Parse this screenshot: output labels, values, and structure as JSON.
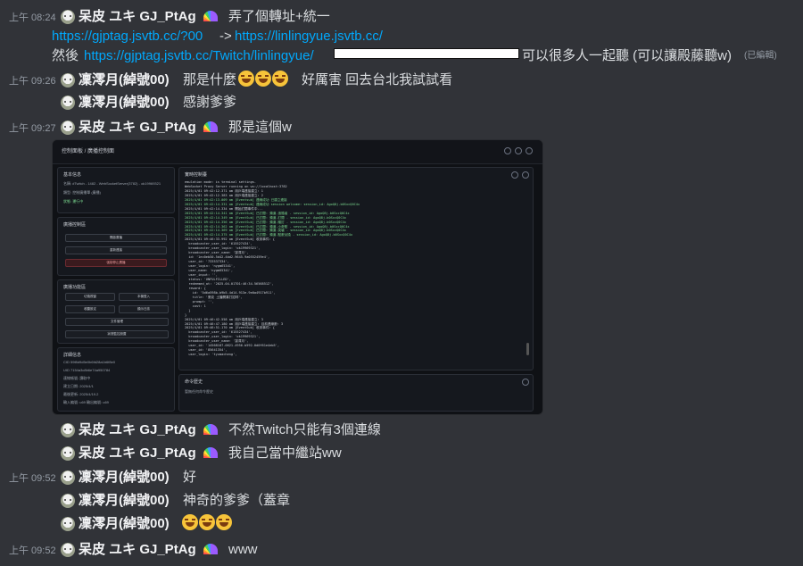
{
  "messages": [
    {
      "time": "上午 08:24",
      "name": "呆皮 ユキ GJ_PtAg",
      "text": "弄了個轉址+統一"
    },
    {
      "link_a": "https://gjptag.jsvtb.cc/?00",
      "arrow": "->",
      "link_b": "https://linlingyue.jsvtb.cc/"
    },
    {
      "prefix": "然後",
      "link": "https://gjptag.jsvtb.cc/Twitch/linlingyue/",
      "text": "可以很多人一起聽 (可以讓殿藤聽w)",
      "edited": "(已編輯)"
    },
    {
      "time": "上午 09:26",
      "name": "凜澪月(綽號00)",
      "text_a": "那是什麼",
      "text_b": "好厲害 回去台北我試試看"
    },
    {
      "name": "凜澪月(綽號00)",
      "text": "感謝爹爹"
    },
    {
      "time": "上午 09:27",
      "name": "呆皮 ユキ GJ_PtAg",
      "text": "那是這個w"
    },
    {
      "name": "呆皮 ユキ GJ_PtAg",
      "text": "不然Twitch只能有3個連線"
    },
    {
      "name": "呆皮 ユキ GJ_PtAg",
      "text": "我自己當中繼站ww"
    },
    {
      "time": "上午 09:52",
      "name": "凜澪月(綽號00)",
      "text": "好"
    },
    {
      "name": "凜澪月(綽號00)",
      "text": "神奇的爹爹（蓋章"
    },
    {
      "name": "凜澪月(綽號00)",
      "text": ""
    },
    {
      "time": "上午 09:52",
      "name": "呆皮 ユキ GJ_PtAg",
      "text": "www"
    }
  ],
  "embed": {
    "title": "控制面板 / 廣播控制面",
    "basic_title": "基本信息",
    "basic_lines": [
      "名稱: #Twitch - 1482 - WebSocketServer(3782) - ok19969321",
      "類型: 控制廣播單 (廣播)",
      "狀態: 運行中"
    ],
    "control_title": "廣播控制區",
    "control_buttons": [
      "開啟廣播",
      "重新連接",
      "強制停止廣播"
    ],
    "ops_title": "廣播功能區",
    "ops_buttons": [
      "切換視窗",
      "本機登入",
      "收聽設定",
      "顯示日誌",
      "文件管理",
      "狀態監控設置"
    ],
    "detail_title": "詳細信息",
    "detail_lines": [
      "CID 59f8d9d5e0b6fd28a1b6f8e0",
      "UID 7154a3c8b6e74a950784",
      "連線帳號: 讀取中",
      "建立日期: 2025/4/1",
      "最後更新: 2025/4/19.2",
      "輸入編號: u69 輸出編號: u69"
    ],
    "log_title": "實時控制臺",
    "log_lines": [
      {
        "t": "emulation mode: is terminal settings.",
        "g": false
      },
      {
        "t": "WebSocket Proxy Server running on ws://localhost:3782",
        "g": false
      },
      {
        "t": "2025/4/01 09:42:12.371 am 用戶端連接建立: 1",
        "g": false
      },
      {
        "t": "2025/4/01 09:42:12.383 am 用戶端連接建立: 2",
        "g": false
      },
      {
        "t": "2025/4/01 09:42:13.009 am [Eventsub] 連線成功 已建立連接",
        "g": true
      },
      {
        "t": "2025/4/01 09:42:14.331 am [Eventsub] 連線成功 session welcome: session_id: AgoQ8j-b0SxcQ0C4x",
        "g": true
      },
      {
        "t": "2025/4/01 09:42:14.334 am 開始訂閱事件中...",
        "g": false
      },
      {
        "t": "2025/4/01 09:42:14.341 am [EventSub] 已訂閱: 頻道.追隨者 - session_id: AgoQ8j-b0SxcQ0C4x",
        "g": true
      },
      {
        "t": "2025/4/01 09:42:14.349 am [EventSub] 已訂閱: 頻道.訂閱 - session_id: AgoQ8j-b0SxcQ0C4x",
        "g": true
      },
      {
        "t": "2025/4/01 09:42:14.356 am [EventSub] 已訂閱: 頻道.贈訂 - session_id: AgoQ8j-b0SxcQ0C4x",
        "g": true
      },
      {
        "t": "2025/4/01 09:42:14.362 am [EventSub] 已訂閱: 頻道.小奇點 - session_id: AgoQ8j-b0SxcQ0C4x",
        "g": true
      },
      {
        "t": "2025/4/01 09:42:14.369 am [EventSub] 已訂閱: 頻道.突襲 - session_id: AgoQ8j-b0SxcQ0C4x",
        "g": true
      },
      {
        "t": "2025/4/01 09:42:14.375 am [EventSub] 已訂閱: 頻道.點數兌換 - session_id: AgoQ8j-b0SxcQ0C4x",
        "g": true
      },
      {
        "t": "2025/4/01 09:46:33.992 am [EventSub] 收到事件: {",
        "g": false
      },
      {
        "t": "  broadcaster_user_id: '615527434',",
        "g": false
      },
      {
        "t": "  broadcaster_user_login: 'ok19969321',",
        "g": false
      },
      {
        "t": "  broadcaster_user_name: '凜澪月',",
        "g": false
      },
      {
        "t": "  id: '1ec0eb50-5d42-4bd2-9645-9a0552459e4',",
        "g": false
      },
      {
        "t": "  user_id: '733537334',",
        "g": false
      },
      {
        "t": "  user_login: 'nygm65341',",
        "g": false
      },
      {
        "t": "  user_name: 'nygm65341',",
        "g": false
      },
      {
        "t": "  user_input: '',",
        "g": false
      },
      {
        "t": "  status: 'UNFULFILLED',",
        "g": false
      },
      {
        "t": "  redeemed_at: '2025-04-01T01:46:34.5656851Z',",
        "g": false
      },
      {
        "t": "  reward: {",
        "g": false
      },
      {
        "t": "    id: '5d6a598b-b9b5-4d14-913e-9e0a4917b911',",
        "g": false
      },
      {
        "t": "    title: '麥克 土播開喜打招呼',",
        "g": false
      },
      {
        "t": "    prompt: '',",
        "g": false
      },
      {
        "t": "    cost: 1",
        "g": false
      },
      {
        "t": "  }",
        "g": false
      },
      {
        "t": "}",
        "g": false
      },
      {
        "t": "2025/4/01 09:46:42.558 am 用戶端連接建立: 3",
        "g": false
      },
      {
        "t": "2025/4/01 09:46:47.180 am 用戶端連接建立: 目前連線數: 3",
        "g": false
      },
      {
        "t": "2025/4/01 09:46:51.170 am [EventSub] 收到事件: {",
        "g": false
      },
      {
        "t": "  broadcaster_user_id: '615527434',",
        "g": false
      },
      {
        "t": "  broadcaster_user_login: 'ok19969321',",
        "g": false
      },
      {
        "t": "  broadcaster_user_name: '凜澪月',",
        "g": false
      },
      {
        "t": "  user_id: '14568187-0621-4956-b592-0d0f61e4eb5',",
        "g": false
      },
      {
        "t": "  user_id: '85641354',",
        "g": false
      },
      {
        "t": "  user_login: 'tyumacheng',",
        "g": false
      }
    ],
    "input_placeholder": "在此可輸入命令，使用回車鍵執行",
    "cmd_title": "命令歷史",
    "cmd_text": "暫無任何命令歷史"
  }
}
